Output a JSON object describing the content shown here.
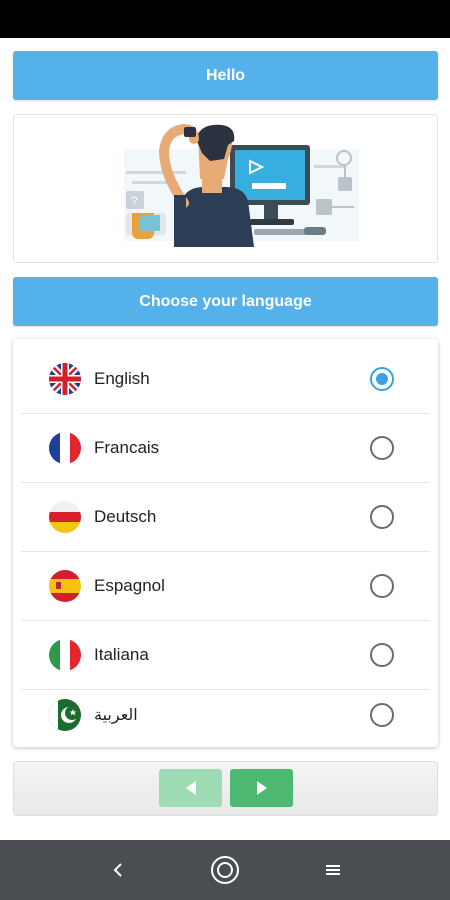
{
  "header": {
    "title": "Hello"
  },
  "section": {
    "title": "Choose your language"
  },
  "languages": [
    {
      "label": "English",
      "flag": "uk-flag-icon",
      "selected": true
    },
    {
      "label": "Francais",
      "flag": "france-flag-icon",
      "selected": false
    },
    {
      "label": "Deutsch",
      "flag": "germany-flag-icon",
      "selected": false
    },
    {
      "label": "Espagnol",
      "flag": "spain-flag-icon",
      "selected": false
    },
    {
      "label": "Italiana",
      "flag": "italy-flag-icon",
      "selected": false
    },
    {
      "label": "العربية",
      "flag": "pakistan-flag-icon",
      "selected": false
    }
  ],
  "navigation": {
    "previous_icon": "arrow-left-icon",
    "next_icon": "arrow-right-icon"
  },
  "system_nav": {
    "back_icon": "back-chevron-icon",
    "home_icon": "home-circle-icon",
    "menu_icon": "menu-lines-icon"
  },
  "colors": {
    "accent": "#55b1ea",
    "radio_selected": "#3aa0e6",
    "next_button": "#4cb872",
    "prev_button": "#9fdcb5"
  }
}
